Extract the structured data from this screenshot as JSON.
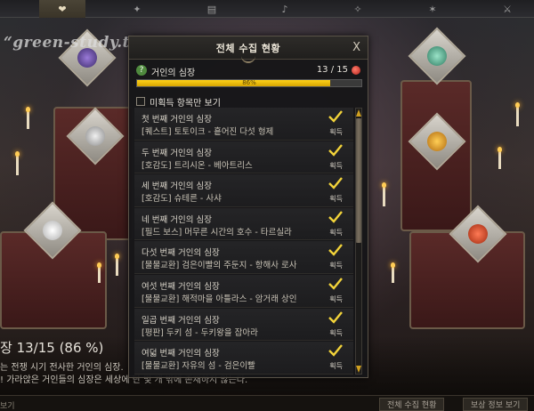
{
  "watermark": "“green-study.tistory.com”",
  "dialog": {
    "title": "전체 수집 현황",
    "close": "X",
    "progress": {
      "help": "?",
      "label": "거인의 심장",
      "count": "13 / 15",
      "percent_text": "86%",
      "fraction": 0.86
    },
    "filter_label": "미획득 항목만 보기",
    "items": [
      {
        "name": "첫 번째 거인의 심장",
        "location": "[퀘스트] 토토이크 - 흩어진 다섯 형제",
        "status": "획득"
      },
      {
        "name": "두 번째 거인의 심장",
        "location": "[호감도] 트리시온 - 베아트리스",
        "status": "획득"
      },
      {
        "name": "세 번째 거인의 심장",
        "location": "[호감도] 슈테른 - 사샤",
        "status": "획득"
      },
      {
        "name": "네 번째 거인의 심장",
        "location": "[필드 보스] 머무른 시간의 호수 - 타르실라",
        "status": "획득"
      },
      {
        "name": "다섯 번째 거인의 심장",
        "location": "[물물교환] 검은이빨의 주둔지 - 항해사 로사",
        "status": "획득"
      },
      {
        "name": "여섯 번째 거인의 심장",
        "location": "[물물교환] 해적마을 아틀라스 - 암거래 상인",
        "status": "획득"
      },
      {
        "name": "일곱 번째 거인의 심장",
        "location": "[평판] 두키 섬 - 두키왕을 잡아라",
        "status": "획득"
      },
      {
        "name": "여덟 번째 거인의 심장",
        "location": "[물물교환] 자유의 섬 - 검은이빨",
        "status": "획득"
      }
    ]
  },
  "bottom": {
    "title": "장 13/15 (86 %)",
    "desc1": "는 전쟁 시기 전사한 거인의 심장.",
    "desc2": "! 가라앉은 거인들의 심장은 세상에 단 몇 개 밖에 존재하지 않는다.",
    "footer_left": "보기",
    "btn1": "전체 수집 현황",
    "btn2": "보상 정보 보기"
  },
  "colors": {
    "accent": "#ffd21a",
    "check": "#f2d33a"
  }
}
